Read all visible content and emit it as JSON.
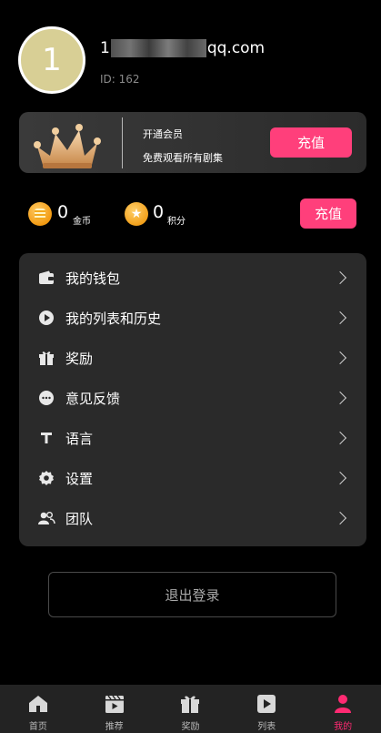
{
  "profile": {
    "avatar_letter": "1",
    "email_prefix": "1",
    "email_suffix": "qq.com",
    "id_text": "ID: 162"
  },
  "vip": {
    "title": "开通会员",
    "subtitle": "免费观看所有剧集",
    "button": "充值"
  },
  "balance": {
    "coins_value": "0",
    "coins_unit": "金币",
    "points_value": "0",
    "points_unit": "积分",
    "button": "充值"
  },
  "menu": {
    "items": [
      {
        "label": "我的钱包",
        "icon": "wallet-icon"
      },
      {
        "label": "我的列表和历史",
        "icon": "play-circle-icon"
      },
      {
        "label": "奖励",
        "icon": "gift-icon"
      },
      {
        "label": "意见反馈",
        "icon": "chat-icon"
      },
      {
        "label": "语言",
        "icon": "text-icon"
      },
      {
        "label": "设置",
        "icon": "gear-icon"
      },
      {
        "label": "团队",
        "icon": "team-icon"
      }
    ]
  },
  "logout_label": "退出登录",
  "tabbar": {
    "tabs": [
      {
        "label": "首页",
        "icon": "home-icon"
      },
      {
        "label": "推荐",
        "icon": "clapperboard-icon"
      },
      {
        "label": "奖励",
        "icon": "gift-icon"
      },
      {
        "label": "列表",
        "icon": "play-box-icon"
      },
      {
        "label": "我的",
        "icon": "user-icon",
        "active": true
      }
    ]
  },
  "colors": {
    "accent": "#ff3f7b",
    "active_tab": "#ff2a72",
    "card_bg": "#2a2a2a",
    "avatar_bg": "#d8cf95"
  }
}
